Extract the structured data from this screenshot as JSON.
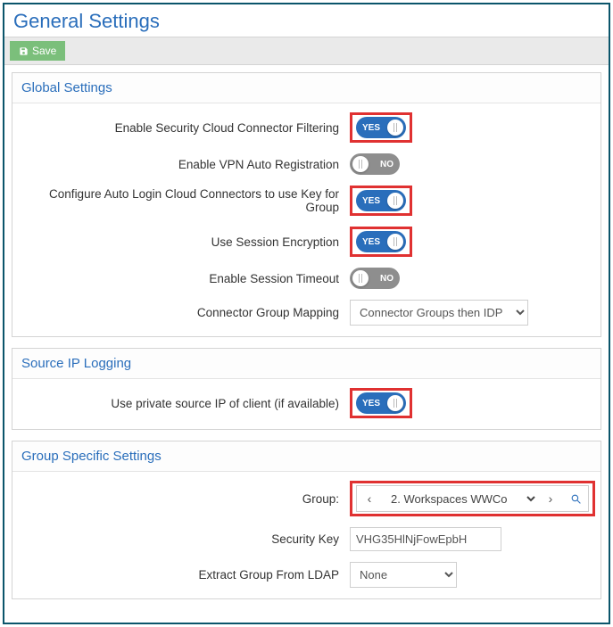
{
  "page_title": "General Settings",
  "toolbar": {
    "save": "Save"
  },
  "panels": {
    "global": {
      "title": "Global Settings",
      "fields": {
        "enable_filtering": {
          "label": "Enable Security Cloud Connector Filtering",
          "value": "YES"
        },
        "enable_vpn": {
          "label": "Enable VPN Auto Registration",
          "value": "NO"
        },
        "auto_login_key": {
          "label": "Configure Auto Login Cloud Connectors to use Key for Group",
          "value": "YES"
        },
        "session_encryption": {
          "label": "Use Session Encryption",
          "value": "YES"
        },
        "session_timeout": {
          "label": "Enable Session Timeout",
          "value": "NO"
        },
        "connector_mapping": {
          "label": "Connector Group Mapping",
          "value": "Connector Groups then IDP"
        }
      }
    },
    "source_ip": {
      "title": "Source IP Logging",
      "fields": {
        "private_ip": {
          "label": "Use private source IP of client (if available)",
          "value": "YES"
        }
      }
    },
    "group_specific": {
      "title": "Group Specific Settings",
      "fields": {
        "group": {
          "label": "Group:",
          "value": "2. Workspaces WWCo"
        },
        "security_key": {
          "label": "Security Key",
          "value": "VHG35HlNjFowEpbH"
        },
        "extract_ldap": {
          "label": "Extract Group From LDAP",
          "value": "None"
        }
      }
    }
  }
}
